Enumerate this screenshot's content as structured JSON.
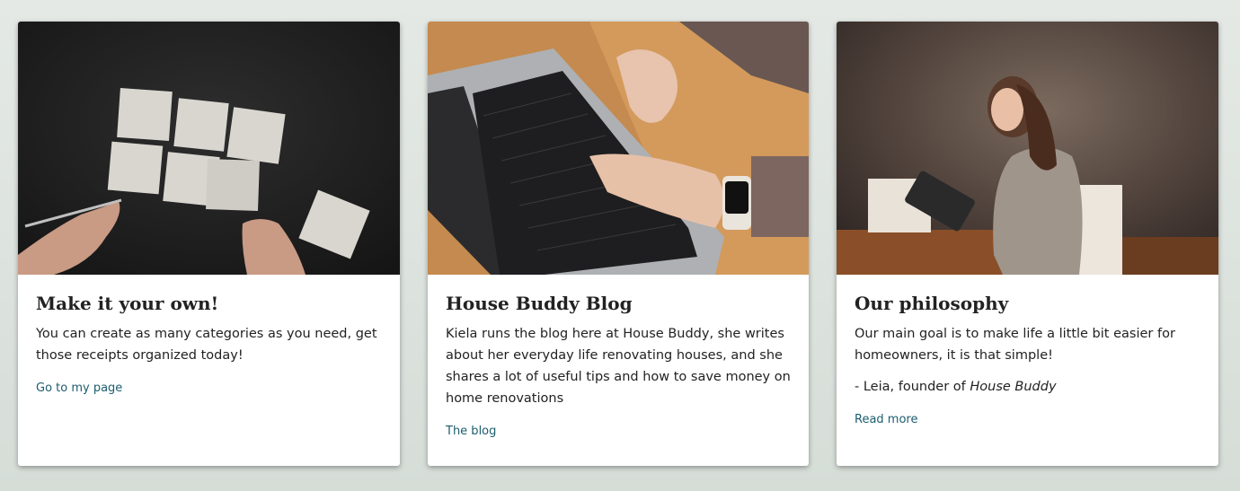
{
  "cards": [
    {
      "title": "Make it your own!",
      "text": "You can create as many categories as you need, get those receipts organized today!",
      "link": "Go to my page",
      "image": "sticky-notes-photo"
    },
    {
      "title": "House Buddy Blog",
      "text": "Kiela runs the blog here at House Buddy, she writes about her everyday life renovating houses, and she shares a lot of useful tips and how to save money on home renovations",
      "link": "The blog",
      "image": "laptop-typing-photo"
    },
    {
      "title": "Our philosophy",
      "text": "Our main goal is to make life a little bit easier for homeowners, it is that simple!",
      "signature_prefix": "- Leia, founder of ",
      "signature_brand": "House Buddy",
      "link": "Read more",
      "image": "woman-with-tablet-photo"
    }
  ],
  "colors": {
    "link": "#1c5d6d",
    "background": "#dde3de"
  }
}
